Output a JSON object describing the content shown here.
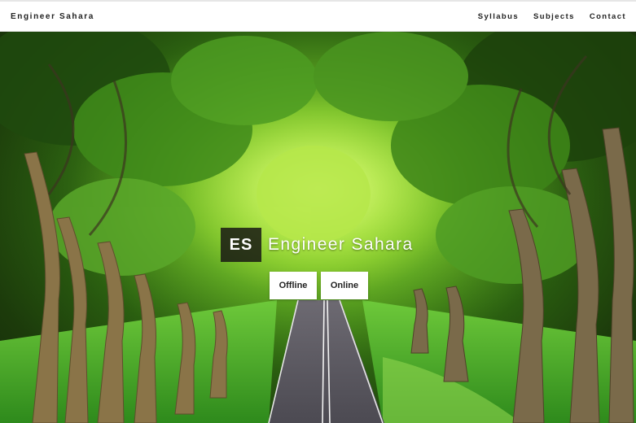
{
  "navbar": {
    "brand": "Engineer Sahara",
    "links": [
      "Syllabus",
      "Subjects",
      "Contact"
    ]
  },
  "hero": {
    "logo_mark": "ES",
    "title": "Engineer Sahara",
    "buttons": [
      "Offline",
      "Online"
    ]
  },
  "colors": {
    "navbar_bg": "#ffffff",
    "logo_box_bg": "#191914",
    "button_bg": "#ffffff",
    "foliage_light": "#c8ef55",
    "foliage_dark": "#1c3b0b"
  }
}
